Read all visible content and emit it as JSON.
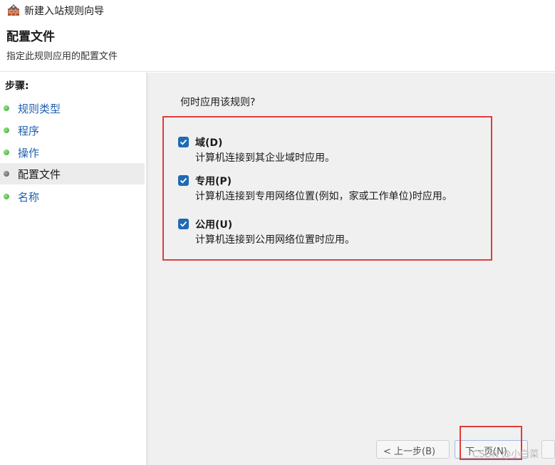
{
  "window": {
    "title": "新建入站规则向导"
  },
  "header": {
    "title": "配置文件",
    "subtitle": "指定此规则应用的配置文件"
  },
  "sidebar": {
    "heading": "步骤:",
    "items": [
      {
        "label": "规则类型",
        "state": "link"
      },
      {
        "label": "程序",
        "state": "link"
      },
      {
        "label": "操作",
        "state": "link"
      },
      {
        "label": "配置文件",
        "state": "current"
      },
      {
        "label": "名称",
        "state": "link"
      }
    ]
  },
  "main": {
    "question": "何时应用该规则?",
    "options": [
      {
        "label": "域(D)",
        "description": "计算机连接到其企业域时应用。",
        "checked": true
      },
      {
        "label": "专用(P)",
        "description": "计算机连接到专用网络位置(例如，家或工作单位)时应用。",
        "checked": true
      },
      {
        "label": "公用(U)",
        "description": "计算机连接到公用网络位置时应用。",
        "checked": true
      }
    ]
  },
  "footer": {
    "back_label": "< 上一步(B)",
    "next_label": "下一页(N)",
    "watermark": "CSDN @小白菜"
  },
  "colors": {
    "accent": "#1f6ab3",
    "highlight": "#e03c3c",
    "link": "#1f5fb0"
  }
}
